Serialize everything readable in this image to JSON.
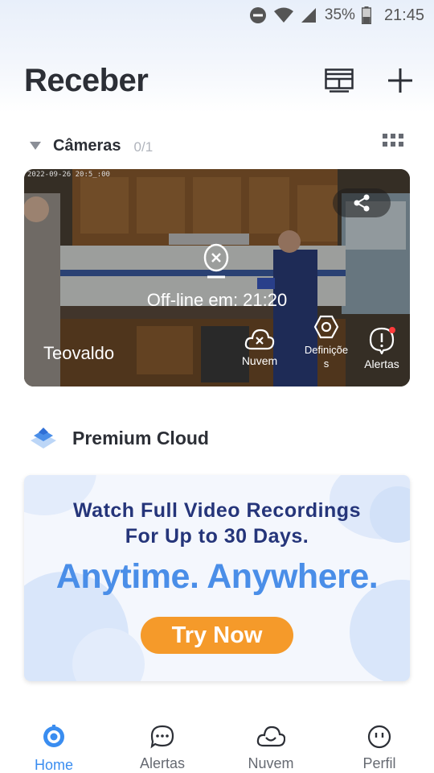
{
  "status_bar": {
    "battery": "35%",
    "time": "21:45"
  },
  "header": {
    "title": "Receber"
  },
  "cameras_section": {
    "title": "Câmeras",
    "count": "0/1"
  },
  "camera": {
    "timestamp": "2022-09-26 20:5_:00",
    "offline_text": "Off-line em: 21:20",
    "device_name": "Teovaldo",
    "actions": {
      "cloud": "Nuvem",
      "settings": "Definiçõe\ns",
      "alerts": "Alertas"
    }
  },
  "premium": {
    "title": "Premium Cloud",
    "promo_line1": "Watch Full Video Recordings",
    "promo_line2": "For Up to 30 Days.",
    "promo_big": "Anytime. Anywhere.",
    "button": "Try Now"
  },
  "nav": {
    "items": [
      {
        "label": "Home",
        "icon": "home-icon",
        "active": true
      },
      {
        "label": "Alertas",
        "icon": "chat-icon",
        "active": false
      },
      {
        "label": "Nuvem",
        "icon": "cloud-icon",
        "active": false
      },
      {
        "label": "Perfil",
        "icon": "profile-icon",
        "active": false
      }
    ]
  },
  "colors": {
    "accent": "#3a8df0",
    "promo_text": "#25357a",
    "promo_big": "#4a8ee8",
    "button": "#f59a2a"
  }
}
